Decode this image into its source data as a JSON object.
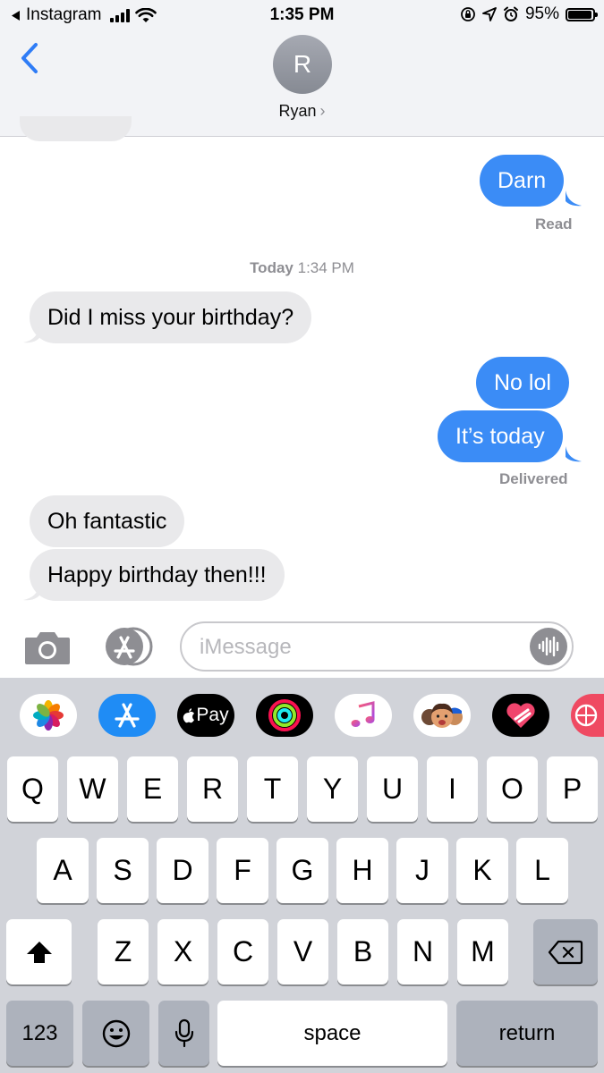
{
  "status_bar": {
    "back_app": "Instagram",
    "time": "1:35 PM",
    "battery": "95%",
    "battery_level": 0.95
  },
  "header": {
    "avatar_initial": "R",
    "contact_name": "Ryan",
    "chevron": "›"
  },
  "conversation": {
    "messages": [
      {
        "text": "Darn",
        "direction": "outgoing"
      },
      {
        "text": "Did I miss your birthday?",
        "direction": "incoming"
      },
      {
        "text": "No lol",
        "direction": "outgoing"
      },
      {
        "text": "It’s today",
        "direction": "outgoing"
      },
      {
        "text": "Oh fantastic",
        "direction": "incoming"
      },
      {
        "text": "Happy birthday then!!!",
        "direction": "incoming"
      }
    ],
    "read_label": "Read",
    "timestamp_day": "Today",
    "timestamp_time": "1:34 PM",
    "delivered_label": "Delivered"
  },
  "composer": {
    "placeholder": "iMessage"
  },
  "app_strip": {
    "apps": [
      "photos-icon",
      "app-store-icon",
      "apple-pay-icon",
      "activity-icon",
      "music-icon",
      "memoji-icon",
      "digital-touch-icon",
      "web-icon"
    ],
    "apple_pay_label": "Pay"
  },
  "keyboard": {
    "row1": [
      "Q",
      "W",
      "E",
      "R",
      "T",
      "Y",
      "U",
      "I",
      "O",
      "P"
    ],
    "row2": [
      "A",
      "S",
      "D",
      "F",
      "G",
      "H",
      "J",
      "K",
      "L"
    ],
    "row3": [
      "Z",
      "X",
      "C",
      "V",
      "B",
      "N",
      "M"
    ],
    "numbers_label": "123",
    "space_label": "space",
    "return_label": "return"
  },
  "colors": {
    "outgoing_bubble": "#3b8cf6",
    "incoming_bubble": "#e9e9eb",
    "ios_blue": "#2f7cf6"
  }
}
